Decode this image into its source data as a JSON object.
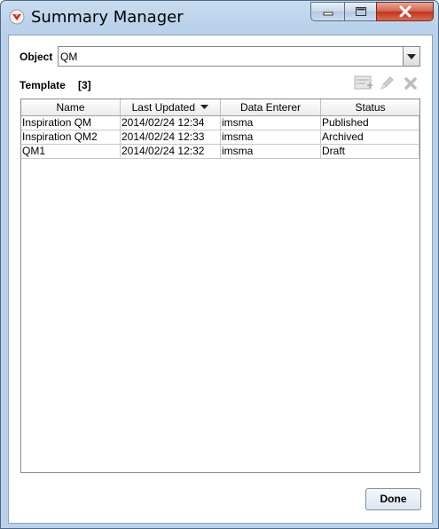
{
  "window": {
    "title": "Summary Manager",
    "icon": "app-icon"
  },
  "object": {
    "label": "Object",
    "selected": "QM"
  },
  "template": {
    "label": "Template",
    "count": "[3]",
    "toolbar_icons": [
      "add-template-icon",
      "edit-icon",
      "delete-icon"
    ]
  },
  "table": {
    "columns": [
      "Name",
      "Last Updated",
      "Data Enterer",
      "Status"
    ],
    "sort_indicator": "sort-descending-icon",
    "rows": [
      [
        "Inspiration QM",
        "2014/02/24 12:34",
        "imsma",
        "Published"
      ],
      [
        "Inspiration QM2",
        "2014/02/24 12:33",
        "imsma",
        "Archived"
      ],
      [
        "QM1",
        "2014/02/24 12:32",
        "imsma",
        "Draft"
      ]
    ]
  },
  "buttons": {
    "done": "Done"
  },
  "colors": {
    "accent": "#b9d1ea",
    "close_button": "#c2341c"
  }
}
